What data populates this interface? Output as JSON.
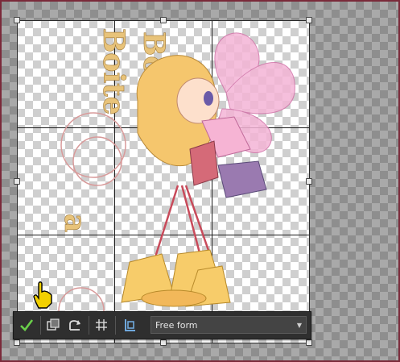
{
  "toolbar": {
    "crop_mode_value": "Free form",
    "accept_icon": "checkmark-icon",
    "snap_icon": "snap-to-layer-icon",
    "rotate_icon": "rotate-icon",
    "grid_icon": "grid-icon",
    "page_icon": "page-size-icon",
    "dropdown_icon": "chevron-down-icon"
  },
  "canvas": {
    "image_text_top": "Boite",
    "image_text_bottom": "a",
    "image_text_side": "Boite"
  },
  "colors": {
    "frame_border": "#7a2a3a",
    "toolbar_bg": "#2f2f2f",
    "accept_green": "#6ad04a"
  }
}
